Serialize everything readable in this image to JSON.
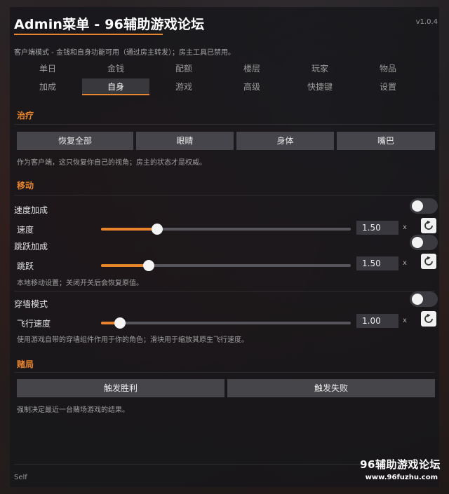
{
  "app": {
    "title": "Admin菜单 - 96辅助游戏论坛",
    "version": "v1.0.4",
    "subtitle": "客户端模式 - 金钱和自身功能可用（通过房主转发）；房主工具已禁用。"
  },
  "tabs": {
    "row1": [
      "单日",
      "金钱",
      "配额",
      "楼层",
      "玩家",
      "物品"
    ],
    "row2": [
      "加成",
      "自身",
      "游戏",
      "高级",
      "快捷键",
      "设置"
    ],
    "active": "自身"
  },
  "heal": {
    "title": "治疗",
    "buttons": [
      "恢复全部",
      "眼睛",
      "身体",
      "嘴巴"
    ],
    "note": "作为客户端，这只恢复你自己的视角；房主的状态才是权威。"
  },
  "move": {
    "title": "移动",
    "speed_boost_label": "速度加成",
    "speed_label": "速度",
    "speed_value": "1.50",
    "speed_fraction": 0.225,
    "jump_boost_label": "跳跃加成",
    "jump_label": "跳跃",
    "jump_value": "1.50",
    "jump_fraction": 0.19,
    "note": "本地移动设置；关闭开关后会恢复原值。",
    "noclip_label": "穿墙模式",
    "fly_label": "飞行速度",
    "fly_value": "1.00",
    "fly_fraction": 0.075,
    "note2": "使用游戏自带的穿墙组件作用于你的角色；滑块用于缩放其原生飞行速度。",
    "unit": "x"
  },
  "gamble": {
    "title": "赌局",
    "win_label": "触发胜利",
    "lose_label": "触发失败",
    "note": "强制决定最近一台赌场游戏的结果。"
  },
  "footer": {
    "left": "Self",
    "watermark_title": "96辅助游戏论坛",
    "watermark_url": "www.96fuzhu.com"
  },
  "colors": {
    "accent": "#e8842c",
    "panel": "#16161a"
  },
  "icons": {
    "reset": "reset-icon",
    "toggle": "toggle-off"
  }
}
